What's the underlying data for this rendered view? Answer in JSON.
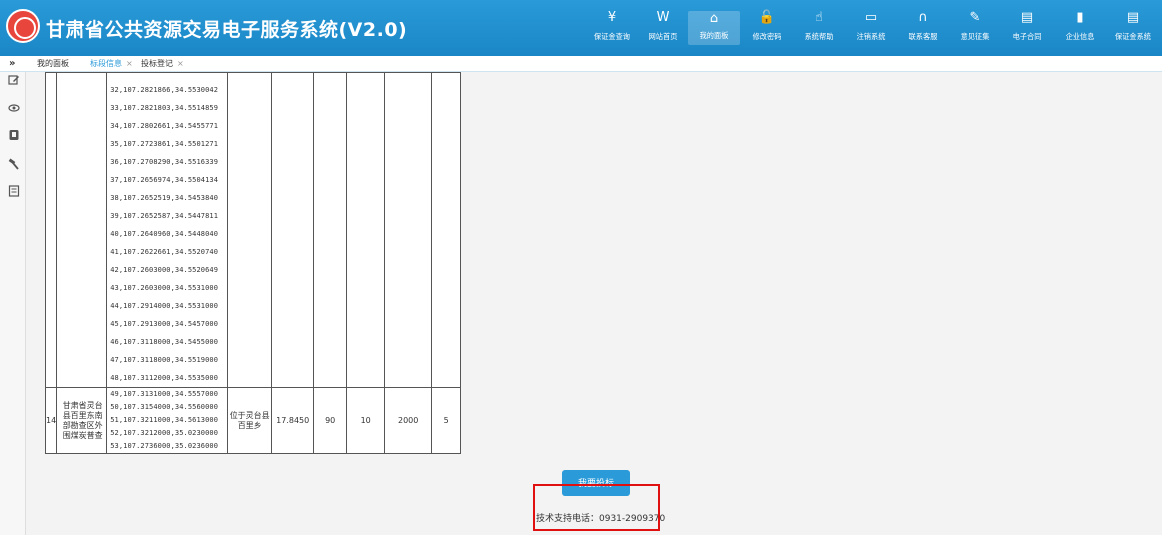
{
  "header": {
    "title": "甘肃省公共资源交易电子服务系统(V2.0)",
    "nav": [
      {
        "icon": "yen-icon",
        "glyph": "¥",
        "label": "保证金查询"
      },
      {
        "icon": "wiki-icon",
        "glyph": "W",
        "label": "网站首页"
      },
      {
        "icon": "home-icon",
        "glyph": "⌂",
        "label": "我的面板"
      },
      {
        "icon": "lock-icon",
        "glyph": "🔓",
        "label": "修改密码"
      },
      {
        "icon": "hand-icon",
        "glyph": "☝",
        "label": "系统帮助"
      },
      {
        "icon": "monitor-icon",
        "glyph": "▭",
        "label": "注销系统"
      },
      {
        "icon": "headset-icon",
        "glyph": "∩",
        "label": "联系客服"
      },
      {
        "icon": "edit-icon",
        "glyph": "✎",
        "label": "意见征集"
      },
      {
        "icon": "contract-icon",
        "glyph": "▤",
        "label": "电子合同"
      },
      {
        "icon": "building-icon",
        "glyph": "▮",
        "label": "企业信息"
      },
      {
        "icon": "deposit-icon",
        "glyph": "▤",
        "label": "保证金系统"
      }
    ]
  },
  "tabs": [
    {
      "label": "我的面板",
      "closable": false
    },
    {
      "label": "标段信息",
      "closable": true
    },
    {
      "label": "投标登记",
      "closable": true
    }
  ],
  "tabbar": {
    "collapse_glyph": "»",
    "close_glyph": "×"
  },
  "sidebar": {
    "icons": [
      "edit-icon",
      "eye-icon",
      "bookmark-icon",
      "hammer-icon",
      "calculator-icon"
    ]
  },
  "table": {
    "upper_coords": [
      "32,107.2821866,34.5530042",
      "33,107.2821803,34.5514859",
      "34,107.2802661,34.5455771",
      "35,107.2723861,34.5501271",
      "36,107.2708290,34.5516339",
      "37,107.2656974,34.5504134",
      "38,107.2652519,34.5453840",
      "39,107.2652587,34.5447811",
      "40,107.2640960,34.5448040",
      "41,107.2622661,34.5520740",
      "42,107.2603000,34.5520649",
      "43,107.2603000,34.5531000",
      "44,107.2914000,34.5531000",
      "45,107.2913000,34.5457000",
      "46,107.3118000,34.5455000",
      "47,107.3118000,34.5519000",
      "48,107.3112000,34.5535000"
    ],
    "row14": {
      "index": "14",
      "name": "甘肃省灵台县百里东南部勘查区外围煤炭普查",
      "coords": [
        "49,107.3131000,34.5557000",
        "50,107.3154000,34.5560000",
        "51,107.3211000,34.5613000",
        "52,107.3212000,35.0230000",
        "53,107.2736000,35.0236000"
      ],
      "location": "位于灵台县百里乡",
      "area": "17.8450",
      "col_a": "90",
      "col_b": "10",
      "col_c": "2000",
      "col_d": "5"
    }
  },
  "actions": {
    "bid_button": "我要投标"
  },
  "footer": {
    "support": "技术支持电话：0931-2909370"
  },
  "colors": {
    "header": "#1a86c6",
    "accent": "#2a9ad8",
    "highlight": "#e01010"
  }
}
